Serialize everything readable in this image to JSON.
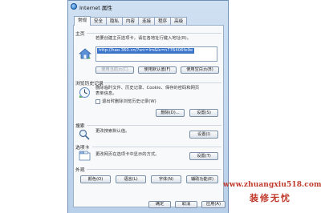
{
  "window": {
    "title": "Internet 属性"
  },
  "tabs": [
    "常规",
    "安全",
    "隐私",
    "内容",
    "连接",
    "程序",
    "高级"
  ],
  "home": {
    "label": "主页",
    "hint": "若要创建主页选项卡，请在各地址行键入地址(R)。",
    "url": "http://hao.360.cn/?src=lm&ls=n776406fe9e",
    "buttons": [
      "使用当前页(C)",
      "使用默认值(F)",
      "使用空白页(B)"
    ]
  },
  "history": {
    "label": "浏览历史记录",
    "hint_line1": "删除临时文件、历史记录、Cookie、保存的密码和网页",
    "hint_line2": "表单信息。",
    "checkbox_label": "退出时删除浏览历史记录(W)",
    "buttons": [
      "删除(D)...",
      "设置(S)"
    ]
  },
  "search": {
    "label": "搜索",
    "hint": "更改搜索默认值。",
    "button": "设置(I)"
  },
  "tabbed": {
    "label": "选项卡",
    "hint": "更改网页在选项卡中显示的方式。",
    "button": "设置(T)"
  },
  "appearance": {
    "label": "外观",
    "buttons": [
      "颜色(O)",
      "语言(L)",
      "字体(N)",
      "辅助功能(E)"
    ]
  },
  "dialog_buttons": [
    "确定",
    "取消",
    "应用(A)"
  ],
  "watermark": {
    "url": "www.zhuangxiu518.com",
    "name": "装修无忧"
  },
  "colors": {
    "accent": "#3a74c9",
    "watermark": "#c0392b"
  }
}
